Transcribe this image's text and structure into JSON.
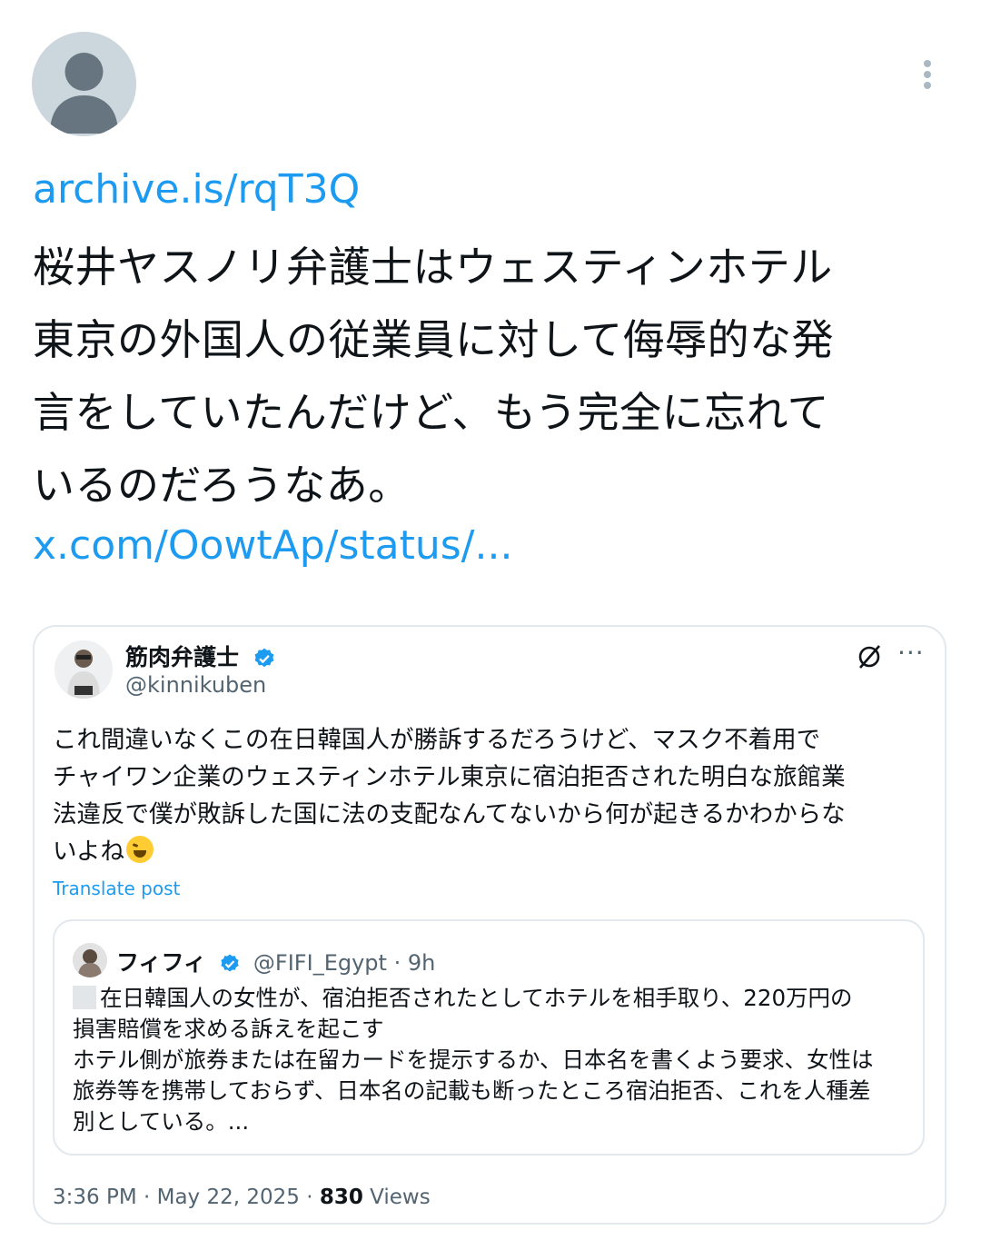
{
  "tweet": {
    "link_top": "archive.is/rqT3Q",
    "text_lines": [
      "桜井ヤスノリ弁護士はウェスティンホテル",
      "東京の外国人の従業員に対して侮辱的な発",
      "言をしていたんだけど、もう完全に忘れて",
      "いるのだろうなあ。"
    ],
    "link_bottom": "x.com/OowtAp/status/..."
  },
  "quote": {
    "name": "筋肉弁護士",
    "handle": "@kinnikuben",
    "text_lines": [
      "これ間違いなくこの在日韓国人が勝訴するだろうけど、マスク不着用で",
      "チャイワン企業のウェスティンホテル東京に宿泊拒否された明白な旅館業",
      "法違反で僕が敗訴した国に法の支配なんてないから何が起きるかわからな",
      "いよね"
    ],
    "emoji": "rolling-on-floor-laughing-emoji",
    "translate_label": "Translate post",
    "inner": {
      "name": "フィフィ",
      "handle_time": "@FIFI_Egypt · 9h",
      "text_lines": [
        "在日韓国人の女性が、宿泊拒否されたとしてホテルを相手取り、220万円の",
        "損害賠償を求める訴えを起こす",
        "ホテル側が旅券または在留カードを提示するか、日本名を書くよう要求、女性は",
        "旅券等を携帯しておらず、日本名の記載も断ったところ宿泊拒否、これを人種差",
        "別としている。..."
      ]
    },
    "meta_time": "3:36 PM · May 22, 2025 · ",
    "views_count": "830",
    "views_label": " Views"
  },
  "colors": {
    "link": "#1d9bf0",
    "verified": "#1d9bf0",
    "secondary_text": "#536471",
    "border": "#e3e8ec"
  }
}
